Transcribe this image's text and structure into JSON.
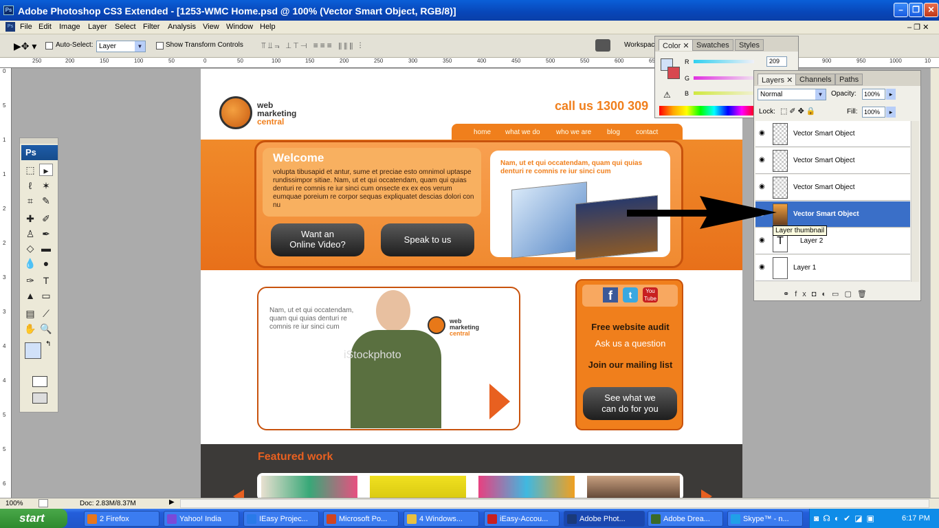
{
  "window": {
    "title": "Adobe Photoshop CS3 Extended - [1253-WMC Home.psd @ 100% (Vector Smart Object, RGB/8)]",
    "app_badge": "Ps"
  },
  "menu": [
    "File",
    "Edit",
    "Image",
    "Layer",
    "Select",
    "Filter",
    "Analysis",
    "View",
    "Window",
    "Help"
  ],
  "options": {
    "auto_select_label": "Auto-Select:",
    "auto_select_value": "Layer",
    "show_transform_label": "Show Transform Controls",
    "workspace_label": "Workspac"
  },
  "ruler_h": [
    "250",
    "200",
    "150",
    "100",
    "50",
    "0",
    "50",
    "100",
    "150",
    "200",
    "250",
    "300",
    "350",
    "400",
    "450",
    "500",
    "550",
    "600",
    "65",
    "900",
    "950",
    "1000",
    "10"
  ],
  "ruler_v": [
    "0",
    "5",
    "1",
    "1",
    "2",
    "2",
    "3",
    "3",
    "4",
    "4",
    "5",
    "5",
    "6",
    "6"
  ],
  "color_panel": {
    "tabs": [
      "Color",
      "Swatches",
      "Styles"
    ],
    "r_label": "R",
    "g_label": "G",
    "b_label": "B",
    "r_value": "209"
  },
  "layers_panel": {
    "tabs": [
      "Layers",
      "Channels",
      "Paths"
    ],
    "blend_mode": "Normal",
    "opacity_label": "Opacity:",
    "opacity_value": "100%",
    "lock_label": "Lock:",
    "fill_label": "Fill:",
    "fill_value": "100%",
    "layers": [
      {
        "name": "Vector Smart Object",
        "selected": false
      },
      {
        "name": "Vector Smart Object",
        "selected": false
      },
      {
        "name": "Vector Smart Object",
        "selected": false
      },
      {
        "name": "Vector Smart Object",
        "selected": true
      },
      {
        "name": "Layer 2",
        "selected": false
      },
      {
        "name": "Layer 1",
        "selected": false
      }
    ],
    "tooltip": "Layer thumbnail"
  },
  "toolbox": {
    "badge": "Ps"
  },
  "status": {
    "zoom": "100%",
    "doc": "Doc: 2.83M/8.37M"
  },
  "site": {
    "logo_line1": "web",
    "logo_line2": "marketing",
    "logo_line3": "central",
    "phone": "call us 1300 309",
    "nav": [
      "home",
      "what we do",
      "who we are",
      "blog",
      "contact"
    ],
    "welcome_title": "Welcome",
    "welcome_body": "volupta tibusapid et antur, sume et preciae esto omnimol uptaspe rundissimpor sitiae. Nam, ut et qui occatendam, quam qui quias denturi re comnis re iur sinci cum onsecte ex ex eos verum eumquae poreium re corpor sequas expliquatet descias dolori con nu",
    "video_btn_l1": "Want an",
    "video_btn_l2": "Online Video?",
    "speak_btn": "Speak to us",
    "promo_text": "Nam, ut et qui occatendam, quam qui quias denturi re comnis re iur sinci cum",
    "card_text": "Nam, ut et qui occatendam, quam qui quias denturi re comnis re iur sinci cum",
    "watermark": "iStockphoto",
    "side": {
      "audit": "Free website audit",
      "ask": "Ask us a question",
      "mailing": "Join our mailing list",
      "see_l1": "See what we",
      "see_l2": "can do for you"
    },
    "featured": "Featured work"
  },
  "taskbar": {
    "start": "start",
    "items": [
      {
        "label": "2 Firefox",
        "color": "#e8761c"
      },
      {
        "label": "Yahoo! India",
        "color": "#7a4ad8"
      },
      {
        "label": "IEasy Projec...",
        "color": "#2a7ae8"
      },
      {
        "label": "Microsoft Po...",
        "color": "#d04420"
      },
      {
        "label": "4 Windows...",
        "color": "#e8c040"
      },
      {
        "label": "iEasy-Accou...",
        "color": "#c82020"
      },
      {
        "label": "Adobe Phot...",
        "color": "#1a3a7a"
      },
      {
        "label": "Adobe Drea...",
        "color": "#3a6a2a"
      },
      {
        "label": "Skype™ - n...",
        "color": "#20a0e8"
      }
    ],
    "clock": "6:17 PM"
  }
}
